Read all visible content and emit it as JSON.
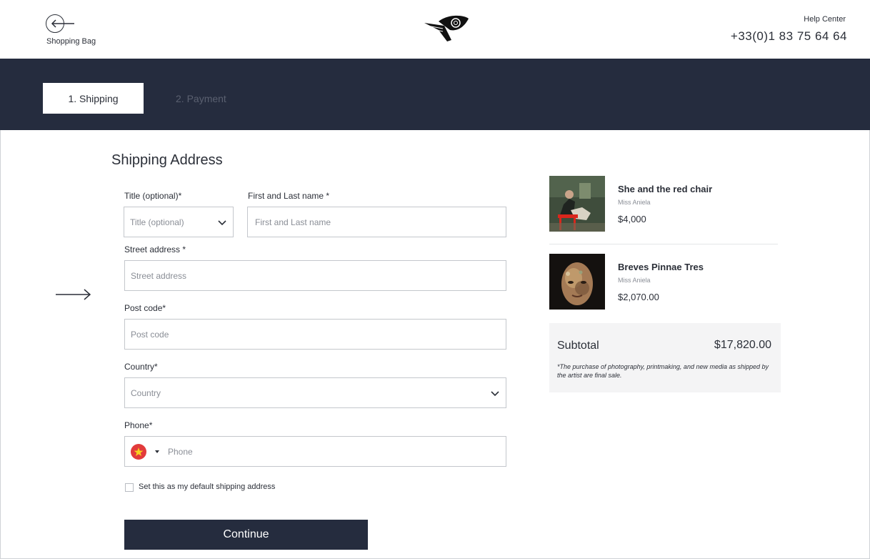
{
  "header": {
    "back_label": "Shopping Bag",
    "help_label": "Help Center",
    "phone": "+33(0)1 83 75 64 64"
  },
  "steps": [
    {
      "label": "1. Shipping",
      "active": true
    },
    {
      "label": "2. Payment",
      "active": false
    }
  ],
  "form": {
    "heading": "Shipping Address",
    "title_label": "Title (optional)*",
    "title_value": "Title (optional)",
    "name_label": "First and Last name *",
    "name_placeholder": "First and Last name",
    "street_label": "Street address *",
    "street_placeholder": "Street address",
    "postcode_label": "Post code*",
    "postcode_placeholder": "Post code",
    "country_label": "Country*",
    "country_value": "Country",
    "phone_label": "Phone*",
    "phone_placeholder": "Phone",
    "default_checkbox_label": "Set this as my default shipping address",
    "continue_label": "Continue"
  },
  "order": {
    "items": [
      {
        "title": "She and the red chair",
        "artist": "Miss Aniela",
        "price": "$4,000"
      },
      {
        "title": "Breves Pinnae Tres",
        "artist": "Miss Aniela",
        "price": "$2,070.00"
      }
    ],
    "subtotal_label": "Subtotal",
    "subtotal_value": "$17,820.00",
    "note": "*The purchase of photography, printmaking, and new media as shipped by the artist are final sale."
  },
  "colors": {
    "navy": "#252c3e",
    "flag_red": "#e23b3b",
    "flag_star": "#f7d21e"
  }
}
